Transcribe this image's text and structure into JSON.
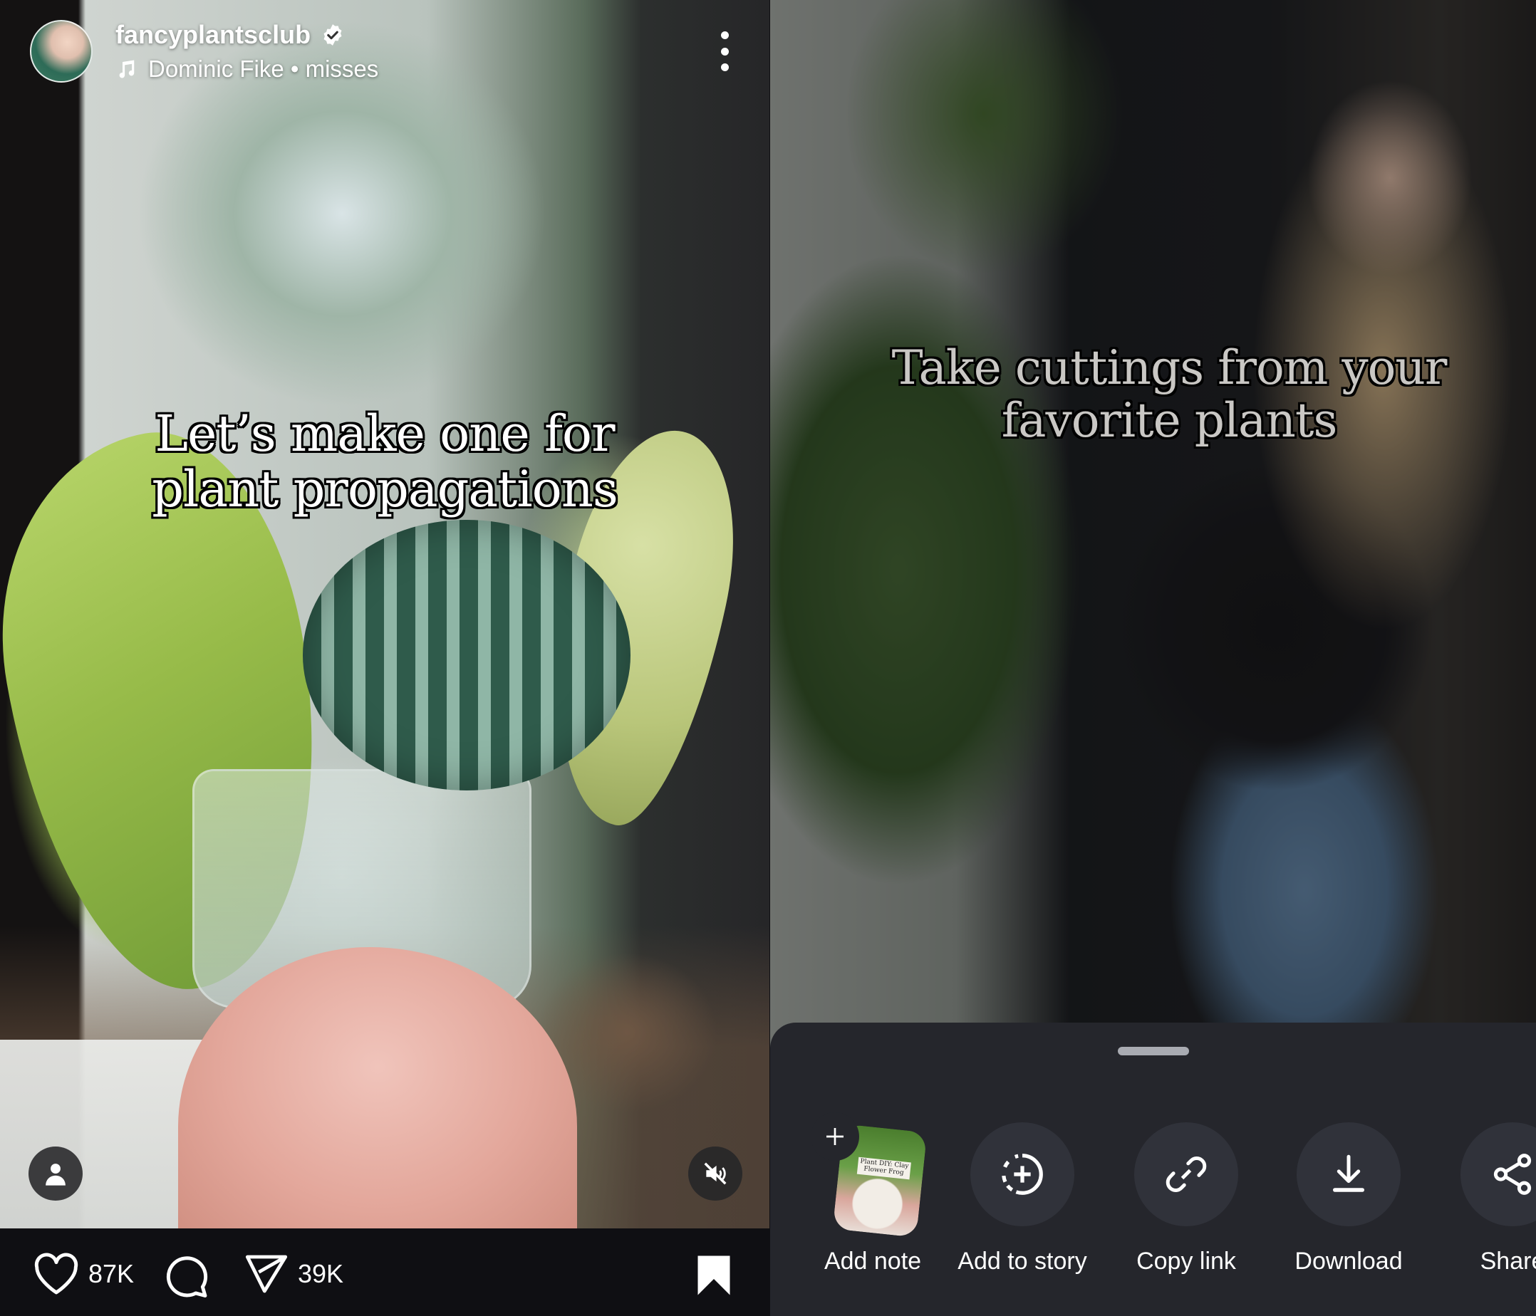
{
  "left_reel": {
    "username": "fancyplantsclub",
    "verified": true,
    "audio": "Dominic Fike • misses",
    "caption_line1": "Let’s make one for",
    "caption_line2": "plant propagations",
    "likes": "87K",
    "shares": "39K",
    "icons": {
      "verified": "verified-badge-icon",
      "music": "music-note-icon",
      "more": "more-vertical-icon",
      "profile": "person-icon",
      "mute": "speaker-muted-icon",
      "like": "heart-icon",
      "comment": "comment-bubble-icon",
      "share": "paper-plane-icon",
      "save": "bookmark-icon"
    }
  },
  "right_reel": {
    "caption_line1": "Take cuttings from your",
    "caption_line2": "favorite plants"
  },
  "share_sheet": {
    "items": [
      {
        "label": "Add note",
        "icon": "note-thumbnail-plus-icon",
        "thumbnail_text": "Plant DIY: Clay Flower Frog"
      },
      {
        "label": "Add to story",
        "icon": "add-to-story-icon"
      },
      {
        "label": "Copy link",
        "icon": "link-icon"
      },
      {
        "label": "Download",
        "icon": "download-icon"
      },
      {
        "label": "Share",
        "icon": "share-nodes-icon"
      }
    ]
  },
  "colors": {
    "bar_bg": "#0f0f13",
    "sheet_bg": "#25262c",
    "sheet_circle": "#30323a",
    "text": "#ffffff"
  }
}
